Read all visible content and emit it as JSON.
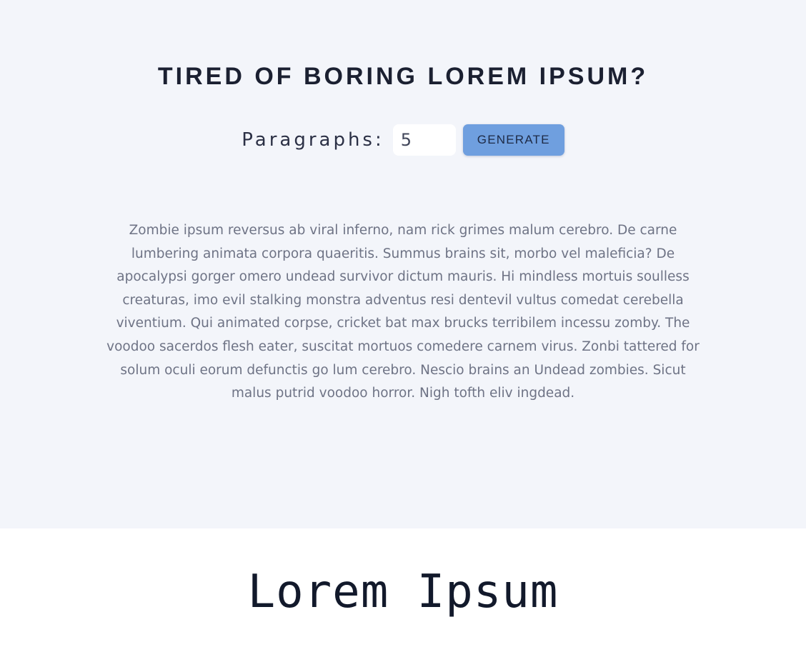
{
  "preview": {
    "headline": "TIRED OF BORING LOREM IPSUM?",
    "controls": {
      "label": "Paragraphs:",
      "amount_value": "5",
      "generate_label": "GENERATE"
    },
    "paragraph": "Zombie ipsum reversus ab viral inferno, nam rick grimes malum cerebro. De carne lumbering animata corpora quaeritis. Summus brains sit, morbo vel maleficia? De apocalypsi gorger omero undead survivor dictum mauris. Hi mindless mortuis soulless creaturas, imo evil stalking monstra adventus resi dentevil vultus comedat cerebella viventium. Qui animated corpse, cricket bat max brucks terribilem incessu zomby. The voodoo sacerdos flesh eater, suscitat mortuos comedere carnem virus. Zonbi tattered for solum oculi eorum defunctis go lum cerebro. Nescio brains an Undead zombies. Sicut malus putrid voodoo horror. Nigh tofth eliv ingdead."
  },
  "caption": "Lorem Ipsum",
  "colors": {
    "preview_background": "#f3f5fa",
    "headline": "#1b2031",
    "button": "#6f9fdf",
    "paragraph": "#6e7385",
    "caption": "#12192b"
  }
}
